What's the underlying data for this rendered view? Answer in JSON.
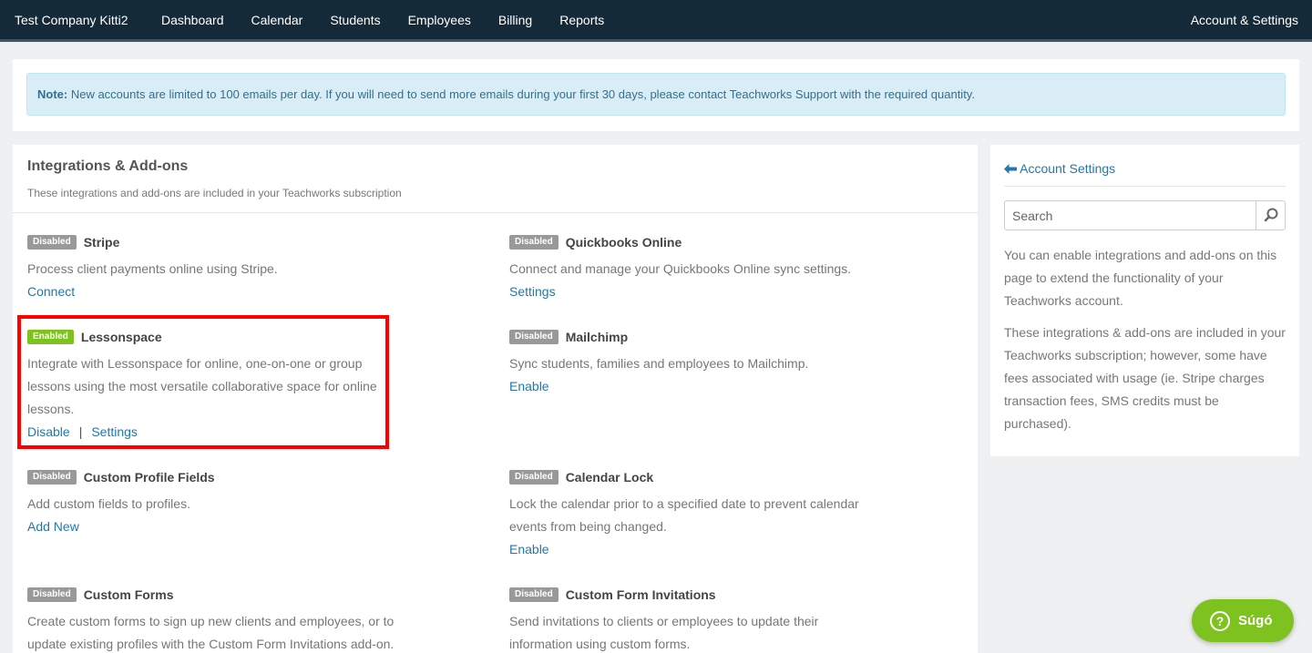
{
  "header": {
    "brand": "Test Company Kitti2",
    "nav": [
      "Dashboard",
      "Calendar",
      "Students",
      "Employees",
      "Billing",
      "Reports"
    ],
    "account": "Account & Settings"
  },
  "note": {
    "label": "Note:",
    "text": " New accounts are limited to 100 emails per day. If you will need to send more emails during your first 30 days, please contact Teachworks Support with the required quantity."
  },
  "integrations": {
    "title": "Integrations & Add-ons",
    "subtitle": "These integrations and add-ons are included in your Teachworks subscription",
    "items": [
      {
        "status": "Disabled",
        "name": "Stripe",
        "desc": "Process client payments online using Stripe.",
        "links": [
          "Connect"
        ]
      },
      {
        "status": "Disabled",
        "name": "Quickbooks Online",
        "desc": "Connect and manage your Quickbooks Online sync settings.",
        "links": [
          "Settings"
        ]
      },
      {
        "status": "Enabled",
        "name": "Lessonspace",
        "desc": "Integrate with Lessonspace for online, one-on-one or group lessons using the most versatile collaborative space for online lessons.",
        "links": [
          "Disable",
          "Settings"
        ]
      },
      {
        "status": "Disabled",
        "name": "Mailchimp",
        "desc": "Sync students, families and employees to Mailchimp.",
        "links": [
          "Enable"
        ]
      },
      {
        "status": "Disabled",
        "name": "Custom Profile Fields",
        "desc": "Add custom fields to profiles.",
        "links": [
          "Add New"
        ]
      },
      {
        "status": "Disabled",
        "name": "Calendar Lock",
        "desc": "Lock the calendar prior to a specified date to prevent calendar events from being changed.",
        "links": [
          "Enable"
        ]
      },
      {
        "status": "Disabled",
        "name": "Custom Forms",
        "desc": "Create custom forms to sign up new clients and employees, or to update existing profiles with the Custom Form Invitations add-on.",
        "links": []
      },
      {
        "status": "Disabled",
        "name": "Custom Form Invitations",
        "desc": "Send invitations to clients or employees to update their information using custom forms.",
        "links": []
      }
    ],
    "link_separator": "|"
  },
  "sidebar": {
    "back_label": "Account Settings",
    "search_placeholder": "Search",
    "para1": "You can enable integrations and add-ons on this page to extend the functionality of your Teachworks account.",
    "para2": "These integrations & add-ons are included in your Teachworks subscription; however, some have fees associated with usage (ie. Stripe charges transaction fees, SMS credits must be purchased)."
  },
  "help": {
    "label": "Súgó",
    "icon": "?"
  },
  "colors": {
    "accent": "#2477ad",
    "enabled": "#7dc21e",
    "disabled": "#999999",
    "topbar": "#142a38",
    "highlight": "#ff0000"
  }
}
